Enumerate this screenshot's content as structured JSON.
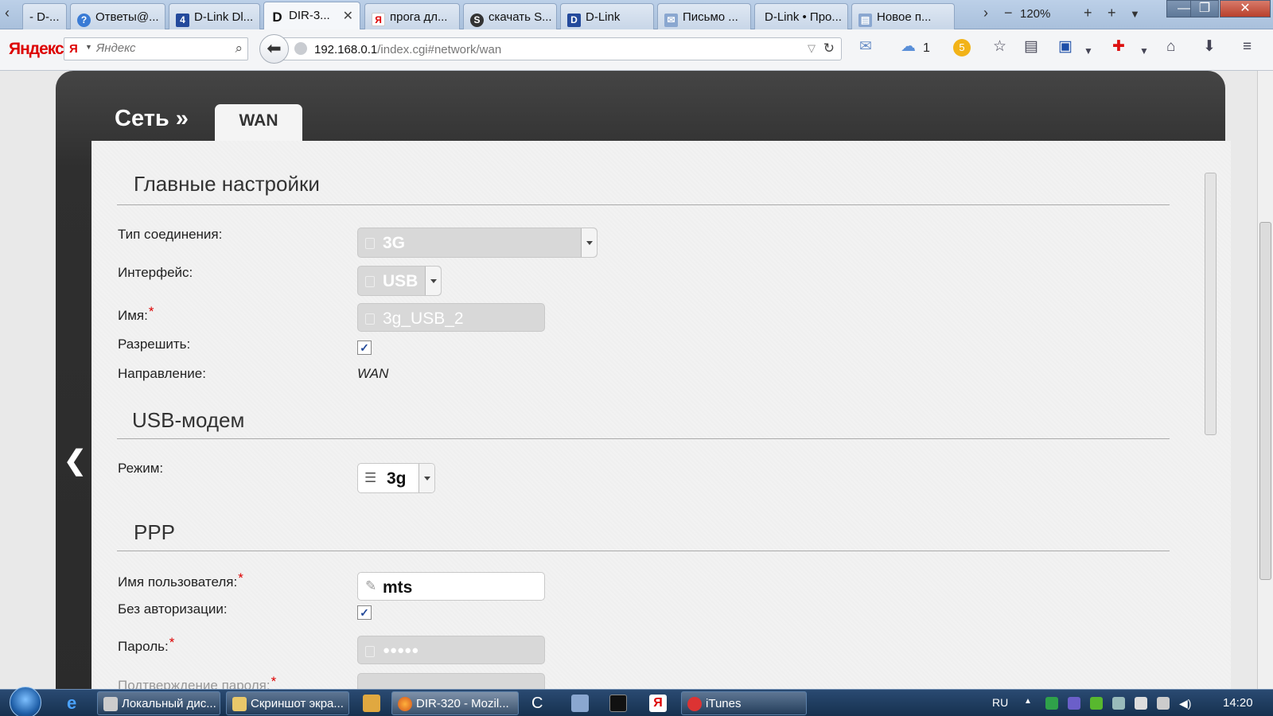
{
  "browser": {
    "tabs": [
      {
        "label": "- D-..."
      },
      {
        "label": "Ответы@..."
      },
      {
        "label": "D-Link Dl..."
      },
      {
        "label": "DIR-3...",
        "active": true
      },
      {
        "label": "прога дл..."
      },
      {
        "label": "скачать S..."
      },
      {
        "label": "D-Link"
      },
      {
        "label": "Письмо ..."
      },
      {
        "label": "D-Link • Про..."
      },
      {
        "label": "Новое п..."
      }
    ],
    "zoom": "120%",
    "yandex_logo": "Яндекс",
    "search_placeholder": "Яндекс",
    "url_host": "192.168.0.1",
    "url_path": "/index.cgi#network/wan",
    "cloud_count": "1",
    "badge_count": "5"
  },
  "page": {
    "section_title": "Сеть »",
    "active_tab": "WAN",
    "groups": {
      "main": "Главные настройки",
      "usb": "USB-модем",
      "ppp": "PPP"
    },
    "fields": {
      "connection_type": {
        "label": "Тип соединения:",
        "value": "3G"
      },
      "interface": {
        "label": "Интерфейс:",
        "value": "USB"
      },
      "name": {
        "label": "Имя:",
        "required": "*",
        "value": "3g_USB_2"
      },
      "enable": {
        "label": "Разрешить:",
        "checked": "✓"
      },
      "direction": {
        "label": "Направление:",
        "value": "WAN"
      },
      "mode": {
        "label": "Режим:",
        "value": "3g"
      },
      "username": {
        "label": "Имя пользователя:",
        "required": "*",
        "value": "mts"
      },
      "no_auth": {
        "label": "Без авторизации:",
        "checked": "✓"
      },
      "password": {
        "label": "Пароль:",
        "required": "*",
        "value": "●●●●●"
      },
      "password_confirm": {
        "label": "Подтверждение пароля:",
        "required": "*"
      }
    }
  },
  "taskbar": {
    "apps": [
      {
        "label": "Локальный дис..."
      },
      {
        "label": "Скриншот экра..."
      },
      {
        "label": "DIR-320 - Mozil..."
      },
      {
        "label": "iTunes"
      }
    ],
    "lang": "RU",
    "time": "14:20"
  }
}
